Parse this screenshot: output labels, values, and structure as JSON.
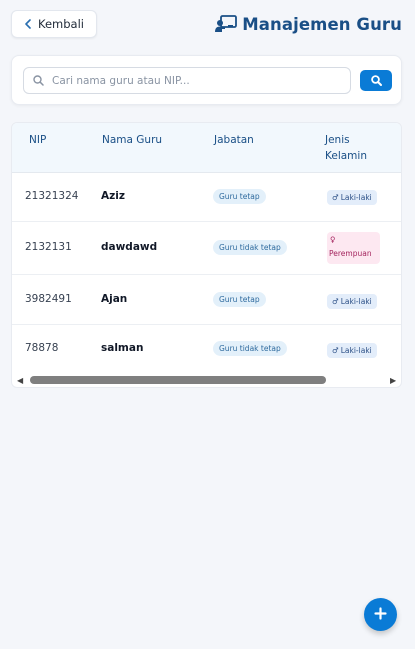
{
  "header": {
    "back_label": "Kembali",
    "title": "Manajemen Guru",
    "title_icon": "teacher-board-icon"
  },
  "search": {
    "placeholder": "Cari nama guru atau NIP...",
    "value": ""
  },
  "table": {
    "columns": [
      "NIP",
      "Nama Guru",
      "Jabatan",
      "Jenis",
      "Kelamin"
    ],
    "rows": [
      {
        "nip": "21321324",
        "name": "Aziz",
        "jabatan": "Guru tetap",
        "gender": "Laki-laki"
      },
      {
        "nip": "2132131",
        "name": "dawdawd",
        "jabatan": "Guru tidak tetap",
        "gender": "Perempuan"
      },
      {
        "nip": "3982491",
        "name": "Ajan",
        "jabatan": "Guru tetap",
        "gender": "Laki-laki"
      },
      {
        "nip": "78878",
        "name": "salman",
        "jabatan": "Guru tidak tetap",
        "gender": "Laki-laki"
      }
    ]
  },
  "colors": {
    "accent": "#0a7bd6",
    "title": "#1a4f86",
    "female_badge": "#fde8f1",
    "male_badge": "#e3edfa"
  }
}
